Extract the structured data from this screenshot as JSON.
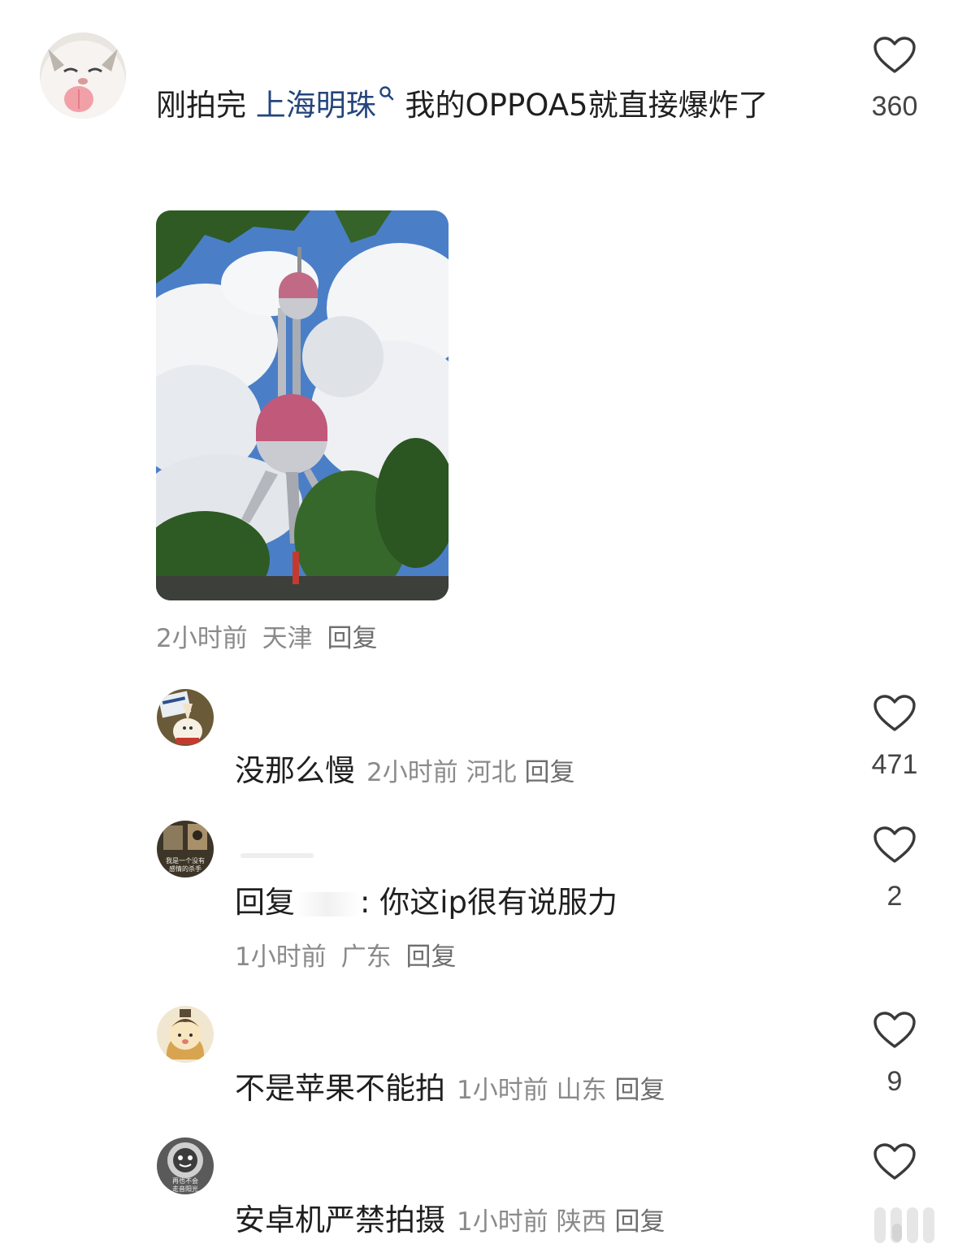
{
  "main_comment": {
    "text_before": "刚拍完 ",
    "topic": "上海明珠",
    "text_after": " 我的OPPOA5就直接爆炸了",
    "likes": "360",
    "time": "2小时前",
    "location": "天津",
    "reply_label": "回复"
  },
  "replies": [
    {
      "text": "没那么慢",
      "time": "2小时前",
      "location": "河北",
      "reply_label": "回复",
      "likes": "471"
    },
    {
      "prefix": "回复",
      "text": ": 你这ip很有说服力",
      "time": "1小时前",
      "location": "广东",
      "reply_label": "回复",
      "likes": "2"
    },
    {
      "text": "不是苹果不能拍",
      "time": "1小时前",
      "location": "山东",
      "reply_label": "回复",
      "likes": "9"
    },
    {
      "text": "安卓机严禁拍摄",
      "time": "1小时前",
      "location": "陕西",
      "reply_label": "回复",
      "likes": ""
    }
  ],
  "avatar_captions": {
    "reply2": "我是一个没有感情的杀手",
    "reply4": "再也不会走音阳光"
  },
  "icons": {
    "like": "heart-outline-icon",
    "topic": "search-icon"
  },
  "colors": {
    "topic": "#24457c",
    "meta": "#8a8a8a",
    "text": "#1f1f1f"
  }
}
